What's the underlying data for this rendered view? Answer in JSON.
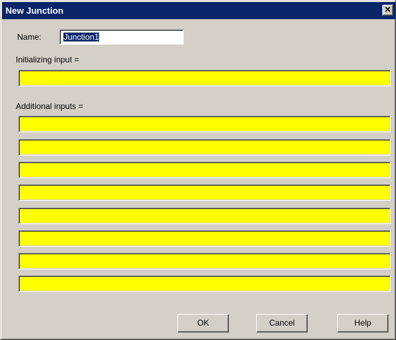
{
  "window": {
    "title": "New Junction",
    "close_glyph": "✕",
    "title_bar_color": "#0a246a",
    "face_color": "#d4d0c8"
  },
  "form": {
    "name_label": "Name:",
    "name_value": "Junction1",
    "initializing_label": "Initializing input =",
    "initializing_value": "",
    "additional_label": "Additional inputs =",
    "additional_inputs": [
      "",
      "",
      "",
      "",
      "",
      "",
      "",
      ""
    ],
    "input_fill_color": "#ffff00"
  },
  "buttons": {
    "ok": "OK",
    "cancel": "Cancel",
    "help": "Help"
  }
}
